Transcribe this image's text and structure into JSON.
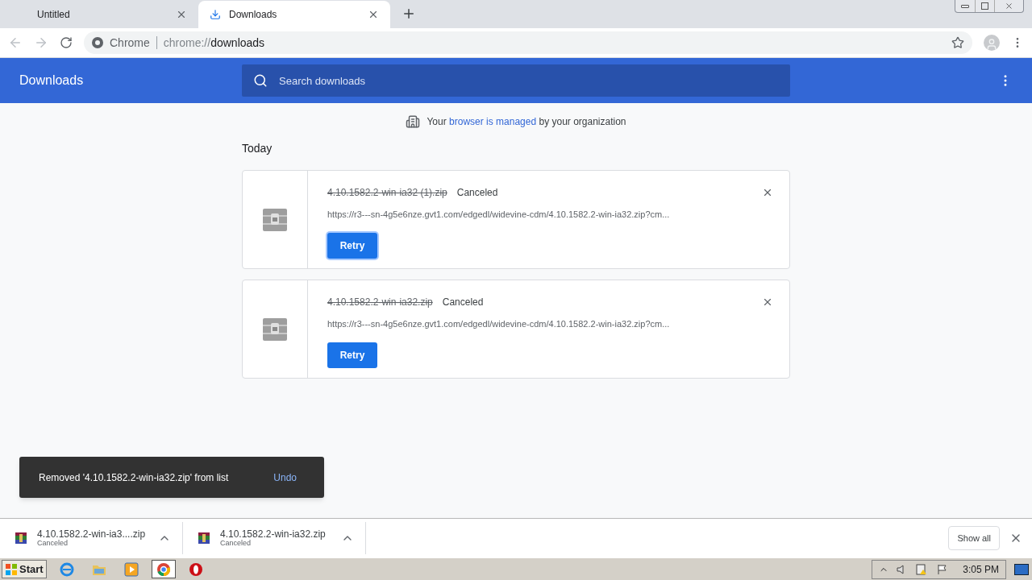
{
  "tabs": [
    {
      "title": "Untitled",
      "selected": false,
      "kind": "blank"
    },
    {
      "title": "Downloads",
      "selected": true,
      "kind": "download"
    }
  ],
  "address": {
    "site": "Chrome",
    "url_scheme": "chrome://",
    "url_path": "downloads"
  },
  "header": {
    "title": "Downloads",
    "search_placeholder": "Search downloads"
  },
  "notice": {
    "before": "Your",
    "link": "browser is managed",
    "after": "by your organization"
  },
  "section": "Today",
  "downloads": [
    {
      "filename": "4.10.1582.2-win-ia32 (1).zip",
      "status": "Canceled",
      "url": "https://r3---sn-4g5e6nze.gvt1.com/edgedl/widevine-cdm/4.10.1582.2-win-ia32.zip?cm...",
      "button": "Retry",
      "focused": true
    },
    {
      "filename": "4.10.1582.2-win-ia32.zip",
      "status": "Canceled",
      "url": "https://r3---sn-4g5e6nze.gvt1.com/edgedl/widevine-cdm/4.10.1582.2-win-ia32.zip?cm...",
      "button": "Retry",
      "focused": false
    }
  ],
  "toast": {
    "message": "Removed '4.10.1582.2-win-ia32.zip' from list",
    "action": "Undo"
  },
  "shelf": {
    "items": [
      {
        "filename": "4.10.1582.2-win-ia3....zip",
        "status": "Canceled"
      },
      {
        "filename": "4.10.1582.2-win-ia32.zip",
        "status": "Canceled"
      }
    ],
    "show_all": "Show all"
  },
  "taskbar": {
    "start": "Start",
    "apps": [
      {
        "kind": "ie",
        "selected": false
      },
      {
        "kind": "folder",
        "selected": false
      },
      {
        "kind": "media",
        "selected": false
      },
      {
        "kind": "chrome",
        "selected": true
      },
      {
        "kind": "opera",
        "selected": false
      }
    ],
    "clock": "3:05 PM"
  }
}
